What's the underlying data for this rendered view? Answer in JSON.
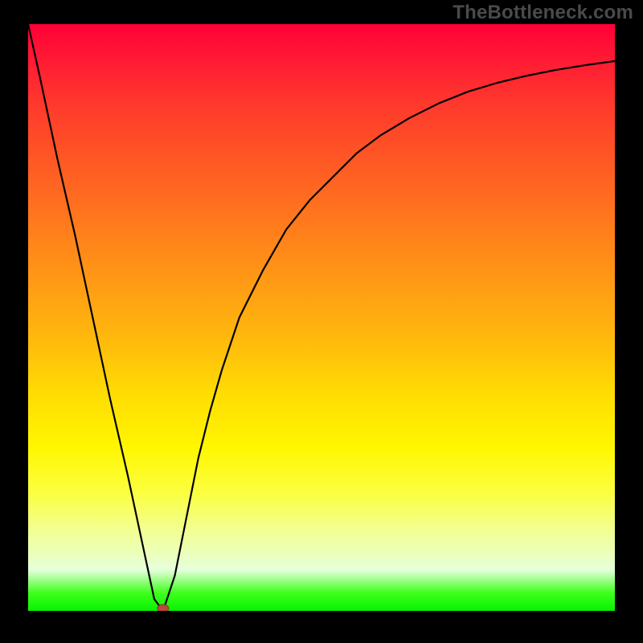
{
  "watermark": "TheBottleneck.com",
  "colors": {
    "frame": "#000000",
    "gradient_top": "#ff0037",
    "gradient_bottom": "#07f300",
    "curve_stroke": "#000000",
    "dot_fill": "#b84a3a"
  },
  "chart_data": {
    "type": "line",
    "title": "",
    "xlabel": "",
    "ylabel": "",
    "xlim": [
      0,
      100
    ],
    "ylim": [
      0,
      100
    ],
    "x": [
      0,
      2,
      5,
      8,
      11,
      14,
      17,
      20,
      21.5,
      23,
      25,
      27,
      29,
      31,
      33,
      36,
      40,
      44,
      48,
      52,
      56,
      60,
      65,
      70,
      75,
      80,
      85,
      90,
      95,
      100
    ],
    "y": [
      100,
      91,
      77,
      64,
      50,
      36,
      23,
      9,
      2,
      0,
      6,
      16,
      26,
      34,
      41,
      50,
      58,
      65,
      70,
      74,
      78,
      81,
      84,
      86.5,
      88.5,
      90,
      91.2,
      92.2,
      93,
      93.7
    ],
    "annotations": [
      {
        "type": "marker",
        "x": 23,
        "y": 0,
        "label": "minimum"
      }
    ]
  }
}
